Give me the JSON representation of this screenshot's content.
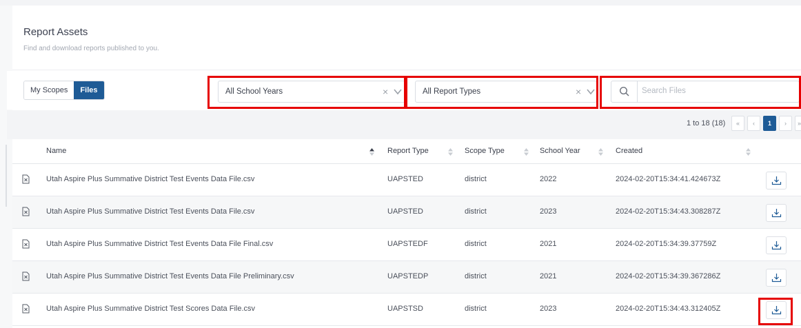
{
  "header": {
    "title": "Report Assets",
    "subtitle": "Find and download reports published to you."
  },
  "toolbar": {
    "tabs": [
      {
        "label": "My Scopes",
        "active": false
      },
      {
        "label": "Files",
        "active": true
      }
    ],
    "school_year_filter": {
      "value": "All School Years"
    },
    "report_type_filter": {
      "value": "All Report Types"
    },
    "search": {
      "placeholder": "Search Files",
      "value": ""
    }
  },
  "pagination": {
    "summary": "1 to 18 (18)",
    "buttons": [
      "«",
      "‹",
      "1",
      "›",
      "»"
    ],
    "current_page": "1"
  },
  "table": {
    "columns": [
      "Name",
      "Report Type",
      "Scope Type",
      "School Year",
      "Created"
    ],
    "rows": [
      {
        "name": "Utah Aspire Plus Summative District Test Events Data File.csv",
        "report_type": "UAPSTED",
        "scope_type": "district",
        "school_year": "2022",
        "created": "2024-02-20T15:34:41.424673Z"
      },
      {
        "name": "Utah Aspire Plus Summative District Test Events Data File.csv",
        "report_type": "UAPSTED",
        "scope_type": "district",
        "school_year": "2023",
        "created": "2024-02-20T15:34:43.308287Z"
      },
      {
        "name": "Utah Aspire Plus Summative District Test Events Data File Final.csv",
        "report_type": "UAPSTEDF",
        "scope_type": "district",
        "school_year": "2021",
        "created": "2024-02-20T15:34:39.37759Z"
      },
      {
        "name": "Utah Aspire Plus Summative District Test Events Data File Preliminary.csv",
        "report_type": "UAPSTEDP",
        "scope_type": "district",
        "school_year": "2021",
        "created": "2024-02-20T15:34:39.367286Z"
      },
      {
        "name": "Utah Aspire Plus Summative District Test Scores Data File.csv",
        "report_type": "UAPSTSD",
        "scope_type": "district",
        "school_year": "2023",
        "created": "2024-02-20T15:34:43.312405Z"
      }
    ]
  },
  "colors": {
    "accent": "#1e5b96",
    "highlight": "#e60000"
  }
}
